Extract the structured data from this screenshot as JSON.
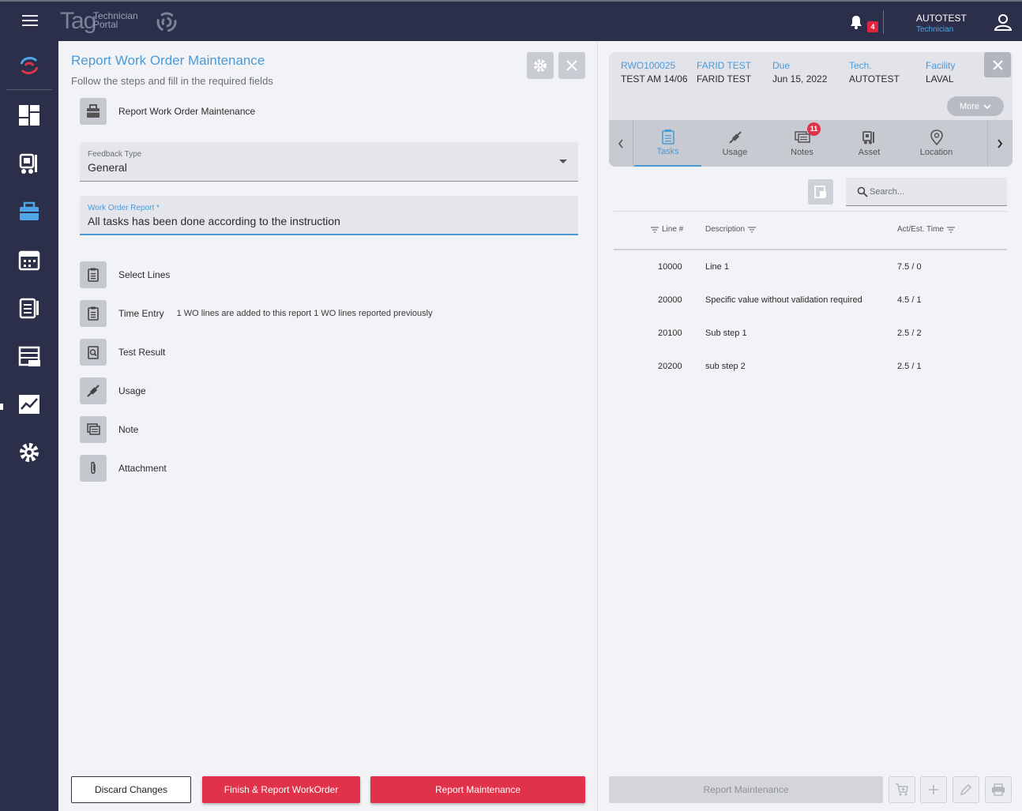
{
  "topbar": {
    "logo_main": "Tag",
    "logo_line1": "Technician",
    "logo_line2": "Portal",
    "notification_count": "4",
    "user_name": "AUTOTEST",
    "user_role": "Technician"
  },
  "sidebar": {
    "items": [
      "logo",
      "dashboard",
      "fleet",
      "work-orders",
      "calendar",
      "checklist",
      "reports",
      "analytics",
      "settings"
    ]
  },
  "form": {
    "title": "Report Work Order Maintenance",
    "subtitle": "Follow the steps and fill in the required fields",
    "header_label": "Report Work Order Maintenance",
    "feedback_type_label": "Feedback Type",
    "feedback_type_value": "General",
    "report_label": "Work Order Report *",
    "report_value": "All tasks has been done according to the instruction",
    "steps": [
      {
        "label": "Select Lines",
        "extra": ""
      },
      {
        "label": "Time Entry",
        "extra": "1 WO lines are added to this report  1 WO lines reported previously"
      },
      {
        "label": "Test Result",
        "extra": ""
      },
      {
        "label": "Usage",
        "extra": ""
      },
      {
        "label": "Note",
        "extra": ""
      },
      {
        "label": "Attachment",
        "extra": ""
      }
    ],
    "discard_label": "Discard Changes",
    "finish_label": "Finish & Report WorkOrder",
    "report_label_btn": "Report Maintenance"
  },
  "work_order": {
    "id": "RWO100025",
    "id_value": "TEST AM 14/06",
    "client_key": "FARID TEST",
    "client_value": "FARID TEST",
    "due_key": "Due",
    "due_value": "Jun 15, 2022",
    "tech_key": "Tech.",
    "tech_value": "AUTOTEST",
    "facility_key": "Facility",
    "facility_value": "LAVAL",
    "more_label": "More"
  },
  "tabs": [
    {
      "label": "Tasks",
      "active": true
    },
    {
      "label": "Usage"
    },
    {
      "label": "Notes",
      "badge": "11"
    },
    {
      "label": "Asset"
    },
    {
      "label": "Location"
    }
  ],
  "search": {
    "placeholder": "Search..."
  },
  "table": {
    "columns": [
      "Line #",
      "Description",
      "Act/Est. Time"
    ],
    "rows": [
      {
        "line": "10000",
        "description": "Line 1",
        "time": "7.5 / 0"
      },
      {
        "line": "20000",
        "description": "Specific value without validation required",
        "time": "4.5 / 1"
      },
      {
        "line": "20100",
        "description": "Sub step 1",
        "time": "2.5 / 2"
      },
      {
        "line": "20200",
        "description": "sub step 2",
        "time": "2.5 / 1"
      }
    ]
  },
  "right_footer": {
    "report_label": "Report Maintenance"
  },
  "colors": {
    "accent": "#4a9ad6",
    "danger": "#e0334a",
    "nav": "#2c2f4a"
  }
}
